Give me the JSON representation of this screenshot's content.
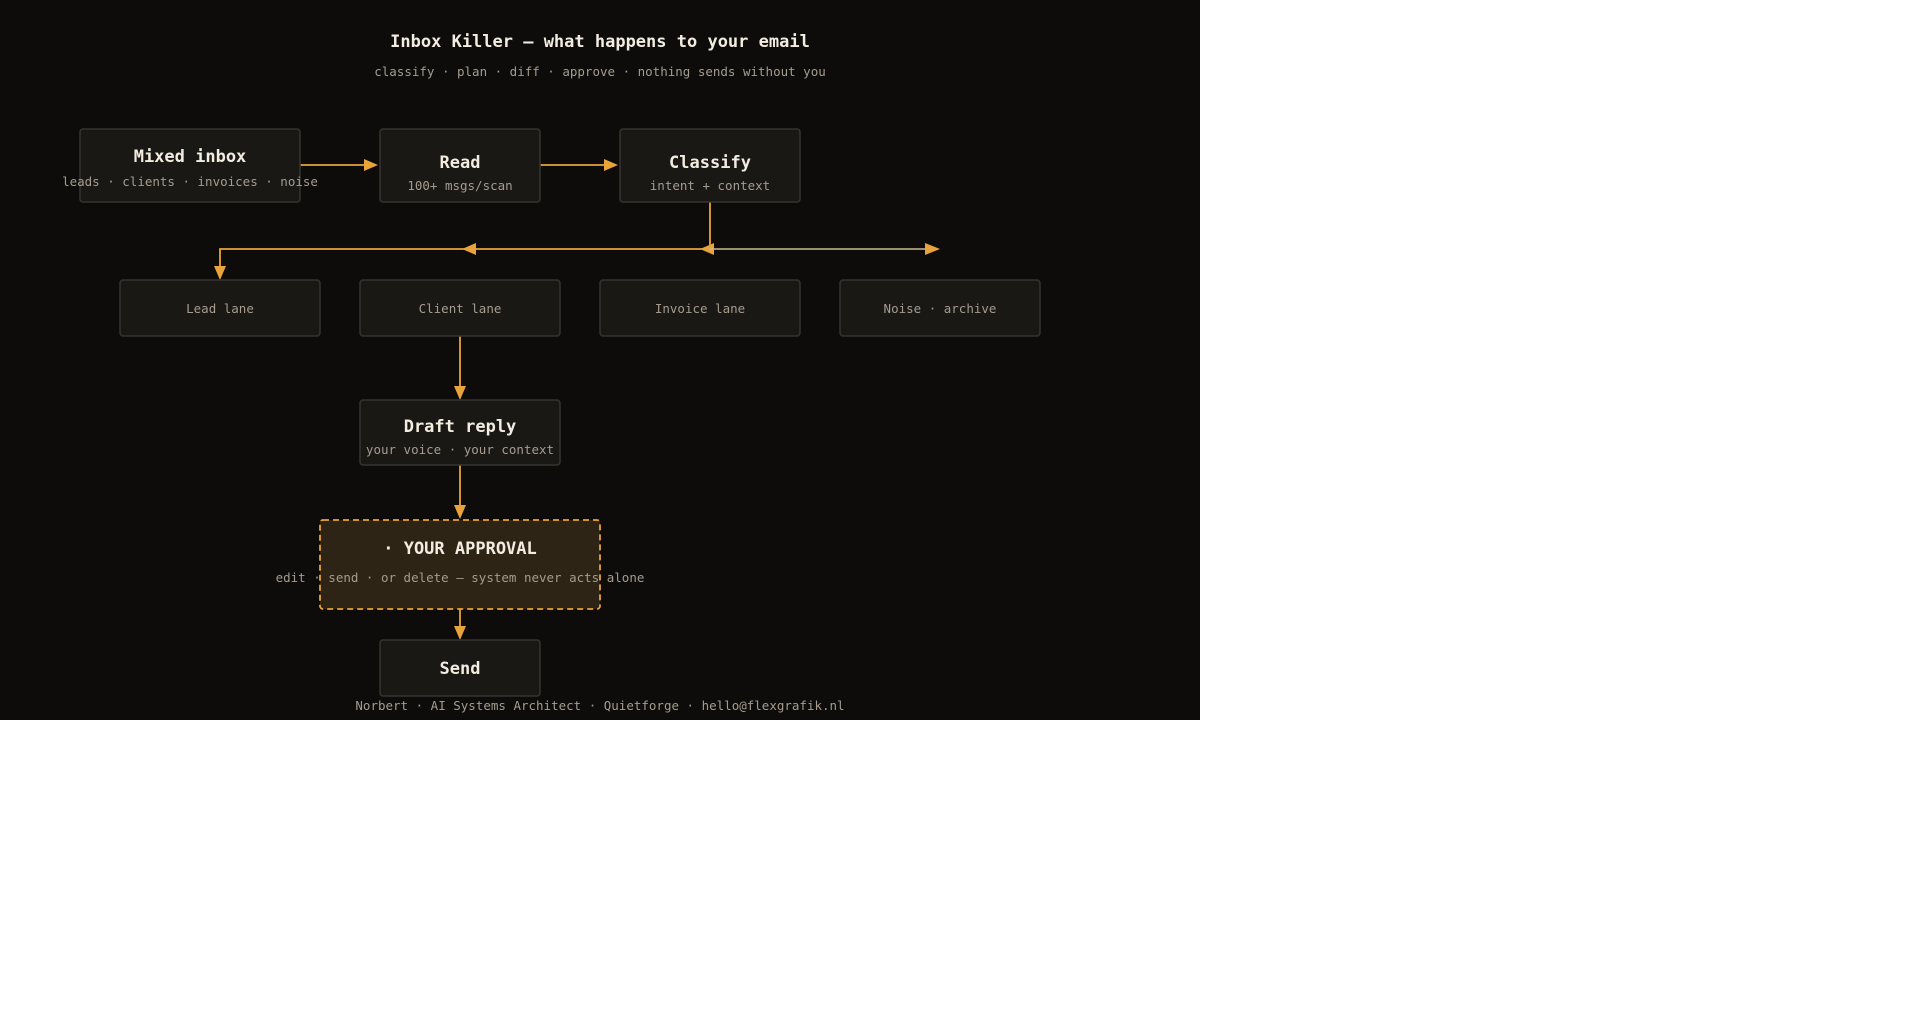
{
  "title": "Inbox Killer — what happens to your email",
  "subtitle": "classify · plan · diff · approve · nothing sends without you",
  "nodes": {
    "mixed_inbox": {
      "label": "Mixed inbox",
      "sub": "leads · clients · invoices · noise"
    },
    "read": {
      "label": "Read",
      "sub": "100+ msgs/scan"
    },
    "classify": {
      "label": "Classify",
      "sub": "intent + context"
    },
    "lead_lane": {
      "label": "Lead lane"
    },
    "client_lane": {
      "label": "Client lane"
    },
    "invoice_lane": {
      "label": "Invoice lane"
    },
    "noise_lane": {
      "label": "Noise · archive"
    },
    "draft_reply": {
      "label": "Draft reply",
      "sub": "your voice · your context"
    },
    "approval": {
      "label": "· YOUR APPROVAL",
      "sub": "edit · send · or delete — system never acts alone"
    },
    "send": {
      "label": "Send"
    }
  },
  "footer": "Norbert · AI Systems Architect · Quietforge · hello@flexgrafik.nl",
  "colors": {
    "background": "#0d0c0b",
    "accent": "#e8a43a",
    "node_fill": "#1a1815",
    "node_stroke": "#38342e",
    "approval_fill": "#2e2416",
    "text_primary": "#f3ece0",
    "text_secondary": "#a59c8e"
  }
}
